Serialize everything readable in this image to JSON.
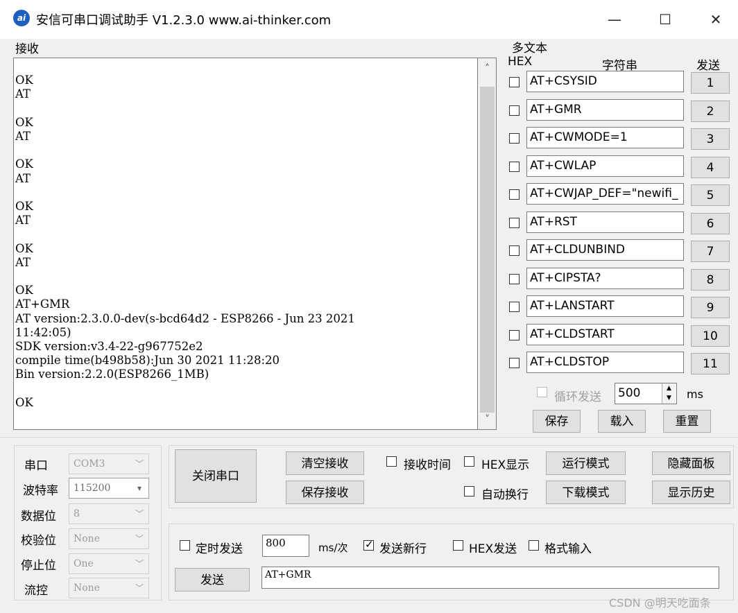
{
  "window": {
    "title": "安信可串口调试助手 V1.2.3.0    www.ai-thinker.com",
    "icon_text": "ai",
    "minimize_glyph": "—",
    "maximize_glyph": "☐",
    "close_glyph": "✕"
  },
  "receive": {
    "group_label": "接收",
    "lines": [
      "",
      "OK",
      "AT",
      "",
      "OK",
      "AT",
      "",
      "OK",
      "AT",
      "",
      "OK",
      "AT",
      "",
      "OK",
      "AT",
      "",
      "OK",
      "AT+GMR",
      "AT version:2.3.0.0-dev(s-bcd64d2 - ESP8266 - Jun 23 2021",
      "11:42:05)",
      "SDK version:v3.4-22-g967752e2",
      "compile time(b498b58):Jun 30 2021 11:28:20",
      "Bin version:2.2.0(ESP8266_1MB)",
      "",
      "OK"
    ],
    "scroll_up": "˄",
    "scroll_down": "˅"
  },
  "multi_text": {
    "group_label": "多文本",
    "col_hex": "HEX",
    "col_string": "字符串",
    "col_send": "发送",
    "rows": [
      {
        "value": "AT+CSYSID",
        "button": "1"
      },
      {
        "value": "AT+GMR",
        "button": "2"
      },
      {
        "value": "AT+CWMODE=1",
        "button": "3"
      },
      {
        "value": "AT+CWLAP",
        "button": "4"
      },
      {
        "value": "AT+CWJAP_DEF=\"newifi_",
        "button": "5"
      },
      {
        "value": "AT+RST",
        "button": "6"
      },
      {
        "value": "AT+CLDUNBIND",
        "button": "7"
      },
      {
        "value": "AT+CIPSTA?",
        "button": "8"
      },
      {
        "value": "AT+LANSTART",
        "button": "9"
      },
      {
        "value": "AT+CLDSTART",
        "button": "10"
      },
      {
        "value": "AT+CLDSTOP",
        "button": "11"
      }
    ],
    "loop_send_label": "循环发送",
    "loop_interval": "500",
    "loop_unit": "ms",
    "save_button": "保存",
    "load_button": "载入",
    "reset_button": "重置"
  },
  "serial": {
    "port_label": "串口",
    "port_value": "COM3",
    "baud_label": "波特率",
    "baud_value": "115200",
    "databits_label": "数据位",
    "databits_value": "8",
    "parity_label": "校验位",
    "parity_value": "None",
    "stopbits_label": "停止位",
    "stopbits_value": "One",
    "flow_label": "流控",
    "flow_value": "None"
  },
  "controls": {
    "close_port": "关闭串口",
    "clear_receive": "清空接收",
    "save_receive": "保存接收",
    "recv_time": "接收时间",
    "hex_display": "HEX显示",
    "run_mode": "运行模式",
    "hide_panel": "隐藏面板",
    "auto_wrap": "自动换行",
    "download_mode": "下载模式",
    "show_history": "显示历史"
  },
  "send": {
    "timed_send": "定时发送",
    "interval": "800",
    "interval_unit": "ms/次",
    "send_newline": "发送新行",
    "hex_send": "HEX发送",
    "format_input": "格式输入",
    "send_button": "发送",
    "send_text": "AT+GMR"
  },
  "watermark": "CSDN @明天吃面条"
}
